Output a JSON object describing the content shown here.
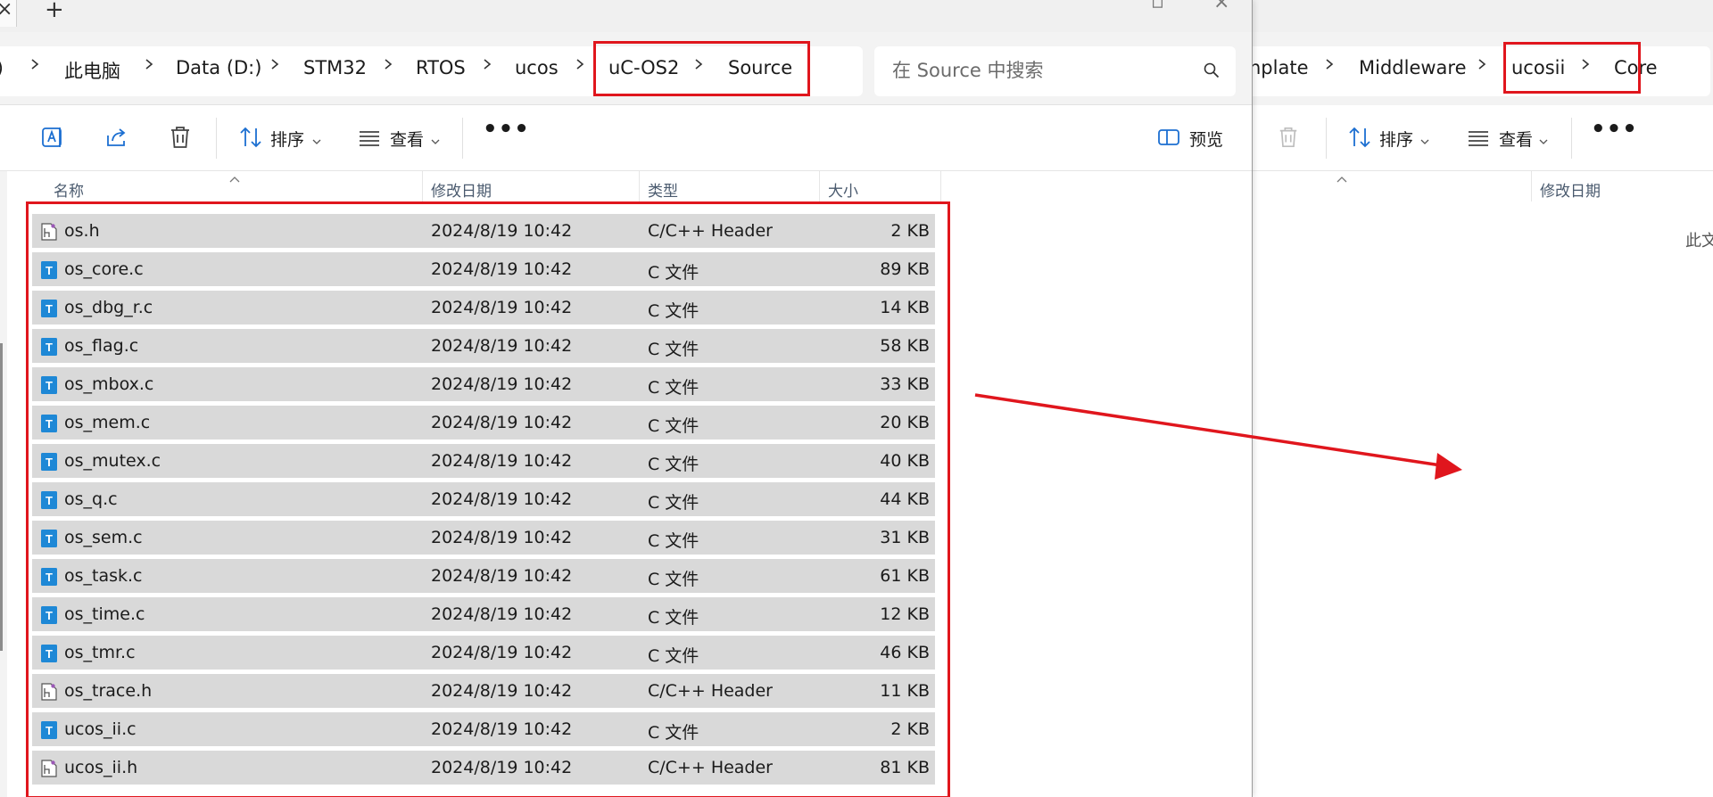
{
  "left_window": {
    "new_tab_glyph": "+",
    "breadcrumb": [
      {
        "label": "此电脑"
      },
      {
        "label": "Data (D:)"
      },
      {
        "label": "STM32"
      },
      {
        "label": "RTOS"
      },
      {
        "label": "ucos"
      },
      {
        "label": "uC-OS2"
      },
      {
        "label": "Source"
      }
    ],
    "search_placeholder": "在 Source 中搜索",
    "toolbar": {
      "sort_label": "排序",
      "view_label": "查看",
      "more_label": "•••",
      "preview_label": "预览"
    },
    "columns": {
      "name": "名称",
      "date": "修改日期",
      "type": "类型",
      "size": "大小"
    },
    "files": [
      {
        "name": "os.h",
        "date": "2024/8/19 10:42",
        "type": "C/C++ Header",
        "size": "2 KB",
        "icon": "header-file-icon"
      },
      {
        "name": "os_core.c",
        "date": "2024/8/19 10:42",
        "type": "C 文件",
        "size": "89 KB",
        "icon": "c-file-icon"
      },
      {
        "name": "os_dbg_r.c",
        "date": "2024/8/19 10:42",
        "type": "C 文件",
        "size": "14 KB",
        "icon": "c-file-icon"
      },
      {
        "name": "os_flag.c",
        "date": "2024/8/19 10:42",
        "type": "C 文件",
        "size": "58 KB",
        "icon": "c-file-icon"
      },
      {
        "name": "os_mbox.c",
        "date": "2024/8/19 10:42",
        "type": "C 文件",
        "size": "33 KB",
        "icon": "c-file-icon"
      },
      {
        "name": "os_mem.c",
        "date": "2024/8/19 10:42",
        "type": "C 文件",
        "size": "20 KB",
        "icon": "c-file-icon"
      },
      {
        "name": "os_mutex.c",
        "date": "2024/8/19 10:42",
        "type": "C 文件",
        "size": "40 KB",
        "icon": "c-file-icon"
      },
      {
        "name": "os_q.c",
        "date": "2024/8/19 10:42",
        "type": "C 文件",
        "size": "44 KB",
        "icon": "c-file-icon"
      },
      {
        "name": "os_sem.c",
        "date": "2024/8/19 10:42",
        "type": "C 文件",
        "size": "31 KB",
        "icon": "c-file-icon"
      },
      {
        "name": "os_task.c",
        "date": "2024/8/19 10:42",
        "type": "C 文件",
        "size": "61 KB",
        "icon": "c-file-icon"
      },
      {
        "name": "os_time.c",
        "date": "2024/8/19 10:42",
        "type": "C 文件",
        "size": "12 KB",
        "icon": "c-file-icon"
      },
      {
        "name": "os_tmr.c",
        "date": "2024/8/19 10:42",
        "type": "C 文件",
        "size": "46 KB",
        "icon": "c-file-icon"
      },
      {
        "name": "os_trace.h",
        "date": "2024/8/19 10:42",
        "type": "C/C++ Header",
        "size": "11 KB",
        "icon": "header-file-icon"
      },
      {
        "name": "ucos_ii.c",
        "date": "2024/8/19 10:42",
        "type": "C 文件",
        "size": "2 KB",
        "icon": "c-file-icon"
      },
      {
        "name": "ucos_ii.h",
        "date": "2024/8/19 10:42",
        "type": "C/C++ Header",
        "size": "81 KB",
        "icon": "header-file-icon"
      }
    ]
  },
  "right_window": {
    "breadcrumb": [
      {
        "label": "nplate"
      },
      {
        "label": "Middleware"
      },
      {
        "label": "ucosii"
      },
      {
        "label": "Core"
      }
    ],
    "toolbar": {
      "sort_label": "排序",
      "view_label": "查看",
      "more_label": "•••"
    },
    "columns": {
      "date": "修改日期"
    },
    "empty_text": "此文"
  },
  "colors": {
    "highlight": "#e0161d",
    "row_selected": "#d9d9d9",
    "c_file_blue": "#1e88d6",
    "column_header_text": "#4a5a6e"
  }
}
